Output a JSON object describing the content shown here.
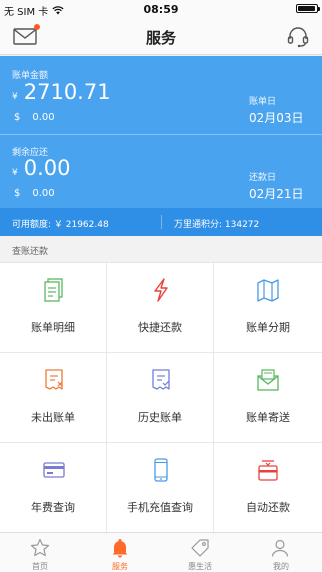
{
  "status_bar": {
    "carrier": "无 SIM 卡",
    "time": "08:59"
  },
  "header": {
    "title": "服务"
  },
  "account": {
    "bill_label": "账单金额",
    "bill_currency": "¥",
    "bill_amount": "2710.71",
    "bill_usd_symbol": "$",
    "bill_usd_amount": "0.00",
    "bill_date_label": "账单日",
    "bill_date": "02月03日",
    "remaining_label": "剩余应还",
    "remaining_currency": "¥",
    "remaining_amount": "0.00",
    "remaining_usd_symbol": "$",
    "remaining_usd_amount": "0.00",
    "due_date_label": "还款日",
    "due_date": "02月21日",
    "available_credit": "可用额度: ￥ 21962.48",
    "points": "万里通积分: 134272"
  },
  "section": {
    "title": "查账还款"
  },
  "services": [
    {
      "label": "账单明细",
      "icon": "bill-detail-icon",
      "color": "#5bb862"
    },
    {
      "label": "快捷还款",
      "icon": "lightning-icon",
      "color": "#e9403d"
    },
    {
      "label": "账单分期",
      "icon": "map-icon",
      "color": "#4a9ae6"
    },
    {
      "label": "未出账单",
      "icon": "receipt-unbilled-icon",
      "color": "#ef7a3a"
    },
    {
      "label": "历史账单",
      "icon": "receipt-history-icon",
      "color": "#6f7fd8"
    },
    {
      "label": "账单寄送",
      "icon": "mail-send-icon",
      "color": "#5bb862"
    },
    {
      "label": "年费查询",
      "icon": "card-icon",
      "color": "#7b7bd3"
    },
    {
      "label": "手机充值查询",
      "icon": "phone-icon",
      "color": "#4a9ae6"
    },
    {
      "label": "自动还款",
      "icon": "auto-pay-icon",
      "color": "#e9403d"
    }
  ],
  "tabs": [
    {
      "label": "首页",
      "icon": "star-icon"
    },
    {
      "label": "服务",
      "icon": "bell-icon"
    },
    {
      "label": "惠生活",
      "icon": "tag-icon"
    },
    {
      "label": "我的",
      "icon": "user-icon"
    }
  ],
  "colors": {
    "primary": "#4aa3ee",
    "primary_dark": "#2f8ee6",
    "accent": "#ff6a2b"
  }
}
